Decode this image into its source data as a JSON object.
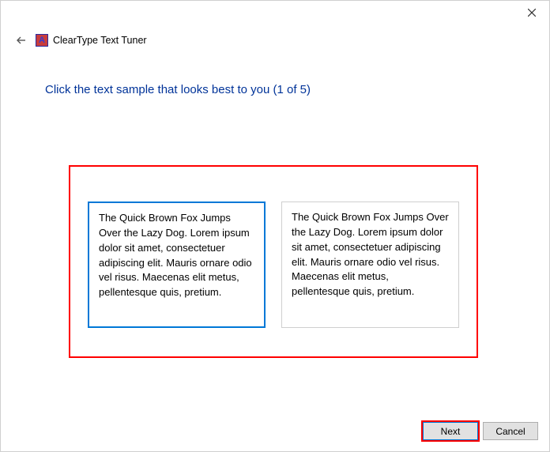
{
  "window": {
    "title": "ClearType Text Tuner"
  },
  "instruction": "Click the text sample that looks best to you (1 of 5)",
  "samples": {
    "left": "The Quick Brown Fox Jumps Over the Lazy Dog. Lorem ipsum dolor sit amet, consectetuer adipiscing elit. Mauris ornare odio vel risus. Maecenas elit metus, pellentesque quis, pretium.",
    "right": "The Quick Brown Fox Jumps Over the Lazy Dog. Lorem ipsum dolor sit amet, consectetuer adipiscing elit. Mauris ornare odio vel risus. Maecenas elit metus, pellentesque quis, pretium."
  },
  "buttons": {
    "next": "Next",
    "cancel": "Cancel"
  }
}
